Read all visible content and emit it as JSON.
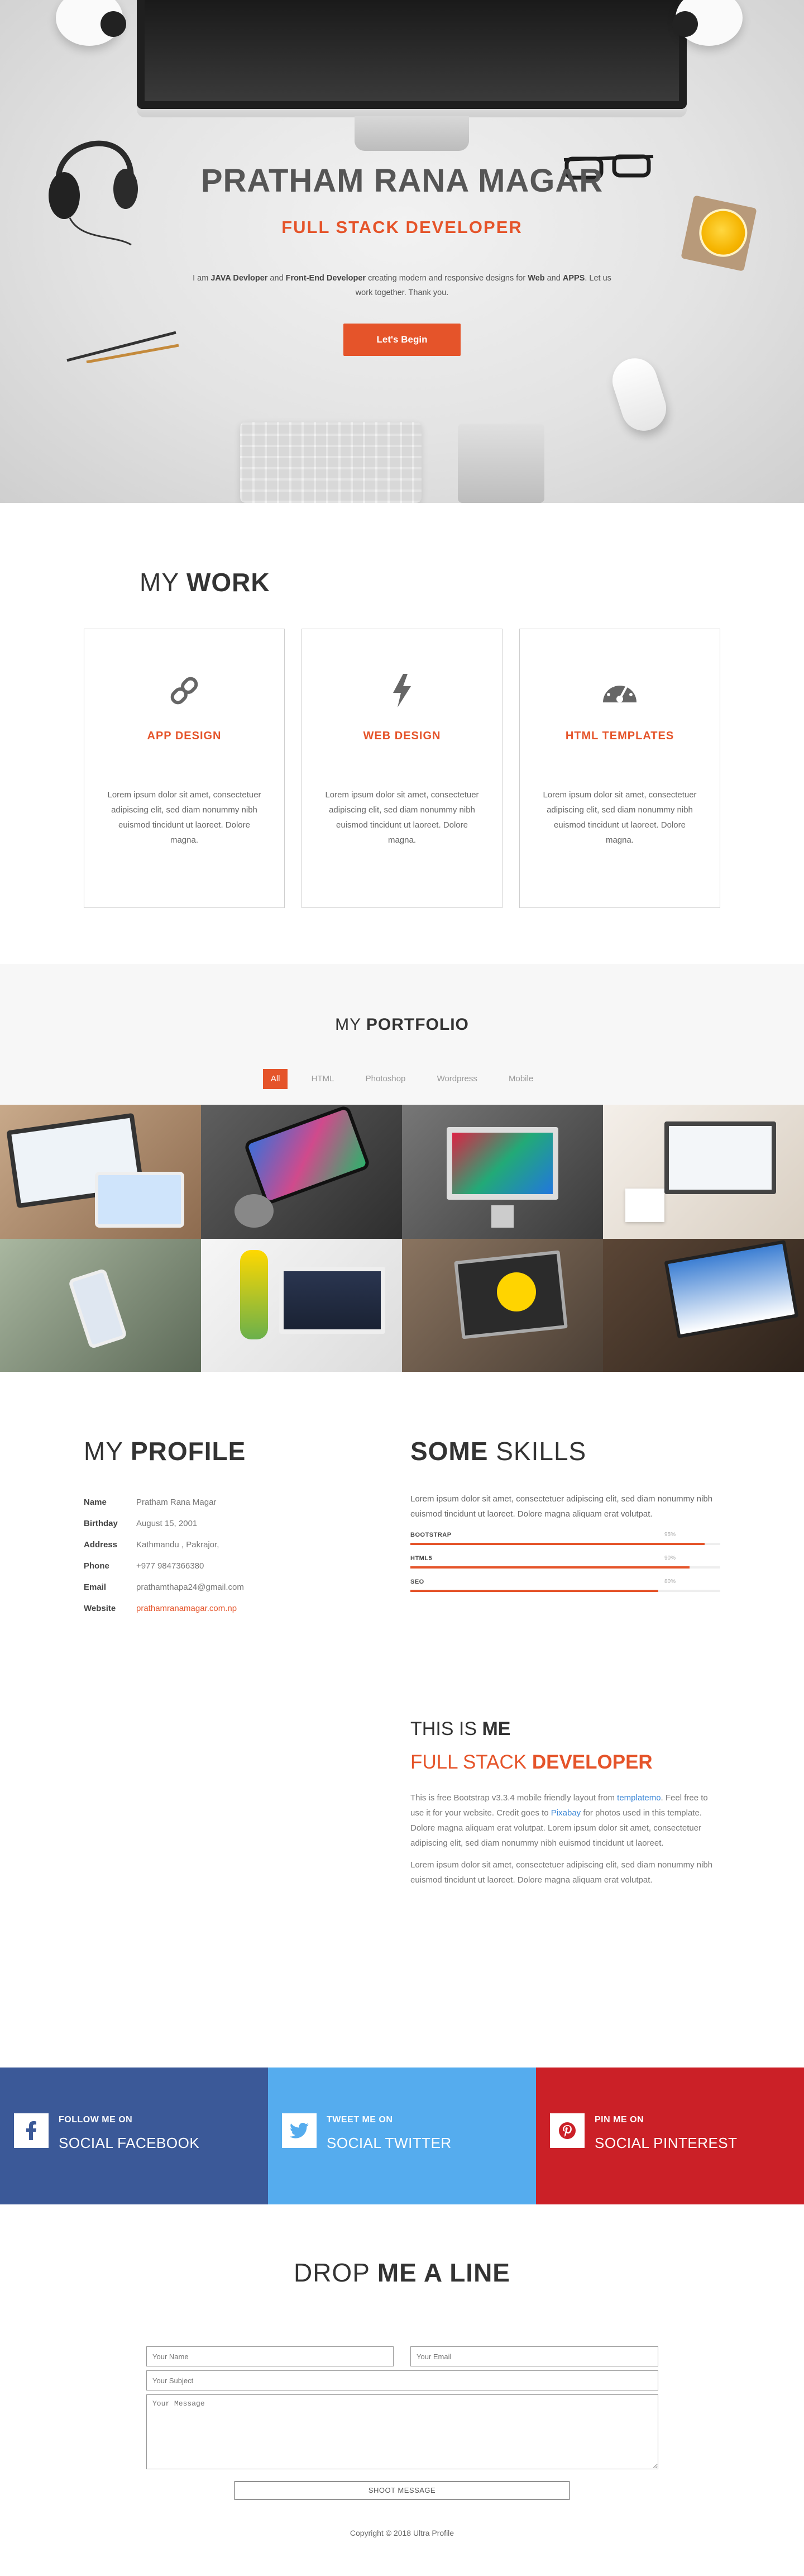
{
  "hero": {
    "name": "PRATHAM RANA MAGAR",
    "role": "FULL STACK DEVELOPER",
    "intro_1": "I am ",
    "intro_java": "JAVA Devloper",
    "intro_2": " and ",
    "intro_fe": "Front-End Developer",
    "intro_3": " creating modern and responsive designs for ",
    "intro_web": "Web",
    "intro_4": " and ",
    "intro_apps": "APPS",
    "intro_5": ". Let us work together. Thank you.",
    "cta": "Let's Begin"
  },
  "work": {
    "title_light": "MY ",
    "title_bold": "WORK",
    "cards": [
      {
        "icon": "link-icon",
        "title": "APP DESIGN",
        "text": "Lorem ipsum dolor sit amet, consectetuer adipiscing elit, sed diam nonummy nibh euismod tincidunt ut laoreet. Dolore magna."
      },
      {
        "icon": "lightning-icon",
        "title": "WEB DESIGN",
        "text": "Lorem ipsum dolor sit amet, consectetuer adipiscing elit, sed diam nonummy nibh euismod tincidunt ut laoreet. Dolore magna."
      },
      {
        "icon": "dashboard-icon",
        "title": "HTML TEMPLATES",
        "text": "Lorem ipsum dolor sit amet, consectetuer adipiscing elit, sed diam nonummy nibh euismod tincidunt ut laoreet. Dolore magna."
      }
    ]
  },
  "portfolio": {
    "title_light": "MY ",
    "title_bold": "PORTFOLIO",
    "filters": [
      "All",
      "HTML",
      "Photoshop",
      "Wordpress",
      "Mobile"
    ],
    "active_filter": "All"
  },
  "profile": {
    "title_light": "MY ",
    "title_bold": "PROFILE",
    "rows": [
      {
        "key": "Name",
        "value": "Pratham Rana Magar"
      },
      {
        "key": "Birthday",
        "value": "August 15, 2001"
      },
      {
        "key": "Address",
        "value": "Kathmandu , Pakrajor,"
      },
      {
        "key": "Phone",
        "value": "+977 9847366380"
      },
      {
        "key": "Email",
        "value": "prathamthapa24@gmail.com"
      },
      {
        "key": "Website",
        "value": "prathamranamagar.com.np"
      }
    ]
  },
  "skills": {
    "title_bold": "SOME",
    "title_light": " SKILLS",
    "text": "Lorem ipsum dolor sit amet, consectetuer adipiscing elit, sed diam nonummy nibh euismod tincidunt ut laoreet. Dolore magna aliquam erat volutpat.",
    "items": [
      {
        "label": "BOOTSTRAP",
        "pct_label": "95%",
        "value": 0.95
      },
      {
        "label": "HTML5",
        "pct_label": "90%",
        "value": 0.9
      },
      {
        "label": "SEO",
        "pct_label": "80%",
        "value": 0.8
      }
    ]
  },
  "about": {
    "title_light": "THIS IS ",
    "title_bold": "ME",
    "sub_light": "FULL STACK ",
    "sub_bold": "DEVELOPER",
    "p1_a": "This is free Bootstrap v3.3.4 mobile friendly layout from ",
    "p1_link1": "templatemo",
    "p1_b": ". Feel free to use it for your website. Credit goes to ",
    "p1_link2": "Pixabay",
    "p1_c": " for photos used in this template. Dolore magna aliquam erat volutpat. Lorem ipsum dolor sit amet, consectetuer adipiscing elit, sed diam nonummy nibh euismod tincidunt ut laoreet.",
    "p2": "Lorem ipsum dolor sit amet, consectetuer adipiscing elit, sed diam nonummy nibh euismod tincidunt ut laoreet. Dolore magna aliquam erat volutpat."
  },
  "social": [
    {
      "icon": "facebook-icon",
      "glyph": "f",
      "line1": "FOLLOW ME ON",
      "line2": "SOCIAL FACEBOOK",
      "color": "#3b5998"
    },
    {
      "icon": "twitter-icon",
      "glyph": "t",
      "line1": "TWEET ME ON",
      "line2": "SOCIAL TWITTER",
      "color": "#55acee"
    },
    {
      "icon": "pinterest-icon",
      "glyph": "p",
      "line1": "PIN ME ON",
      "line2": "SOCIAL PINTEREST",
      "color": "#cb2027"
    }
  ],
  "contact": {
    "title_light": "DROP ",
    "title_bold": "ME A LINE",
    "name_placeholder": "Your Name",
    "email_placeholder": "Your Email",
    "subject_placeholder": "Your Subject",
    "message_placeholder": "Your Message",
    "submit": "SHOOT MESSAGE",
    "copyright": "Copyright © 2018 Ultra Profile"
  },
  "colors": {
    "accent": "#e5542a",
    "facebook": "#3b5998",
    "twitter": "#55acee",
    "pinterest": "#cb2027"
  }
}
